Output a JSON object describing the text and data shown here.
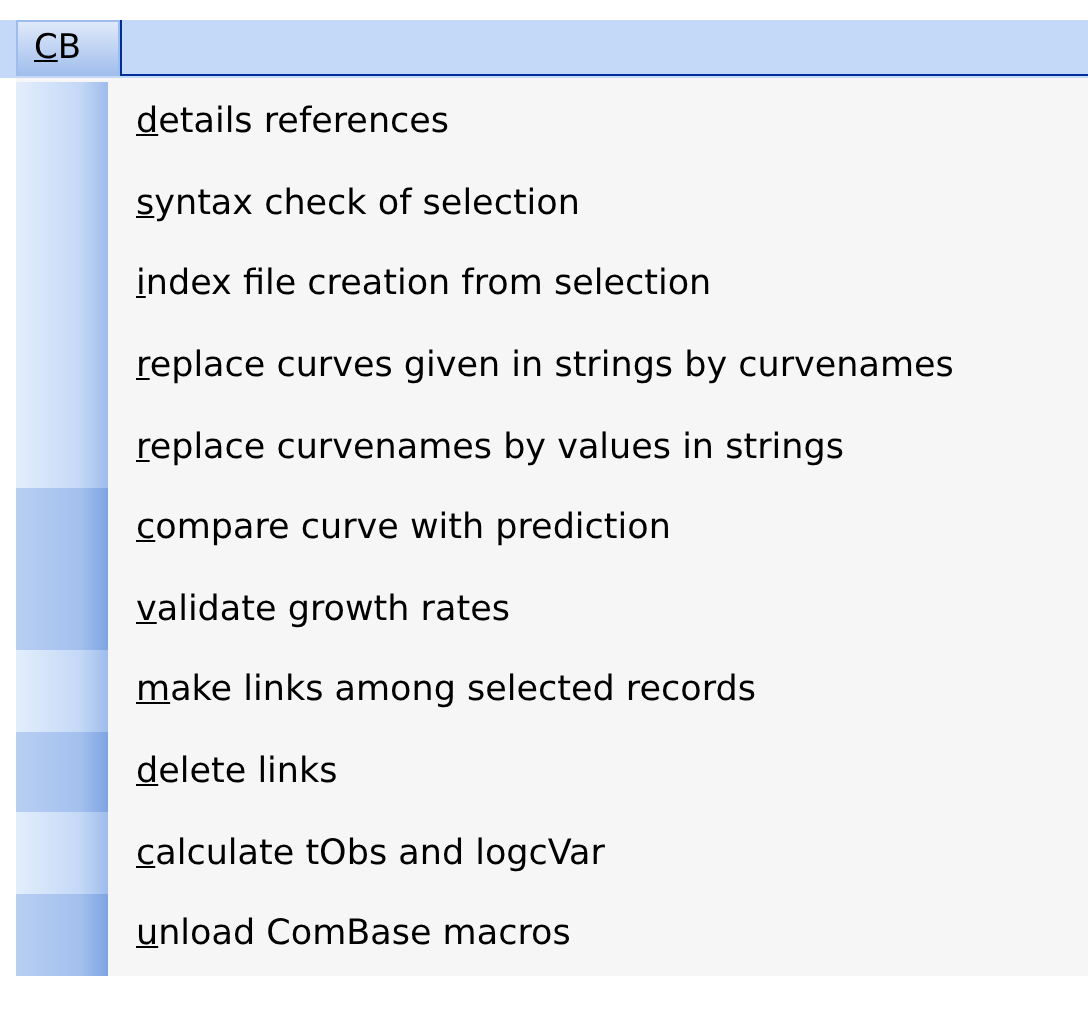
{
  "menu_bar": {
    "menus": [
      {
        "access_key": "C",
        "rest": "B",
        "selected": true
      }
    ]
  },
  "menu": {
    "items": [
      {
        "access_key": "d",
        "rest": "etails references",
        "infrequent": false
      },
      {
        "access_key": "s",
        "rest": "yntax check of selection",
        "infrequent": false
      },
      {
        "access_key": "i",
        "rest": "ndex file creation from selection",
        "infrequent": false
      },
      {
        "access_key": "r",
        "rest": "eplace curves given in strings by curvenames",
        "infrequent": false
      },
      {
        "access_key": "r",
        "rest": "eplace curvenames by values in strings",
        "infrequent": false
      },
      {
        "access_key": "c",
        "rest": "ompare curve with prediction",
        "infrequent": true
      },
      {
        "access_key": "v",
        "rest": "alidate growth rates",
        "infrequent": true
      },
      {
        "access_key": "m",
        "rest": "ake links among selected records",
        "infrequent": false
      },
      {
        "access_key": "d",
        "rest": "elete links",
        "infrequent": true
      },
      {
        "access_key": "c",
        "rest": "alculate tObs and logcVar",
        "infrequent": false
      },
      {
        "access_key": "u",
        "rest": "nload ComBase macros",
        "infrequent": true
      }
    ]
  }
}
